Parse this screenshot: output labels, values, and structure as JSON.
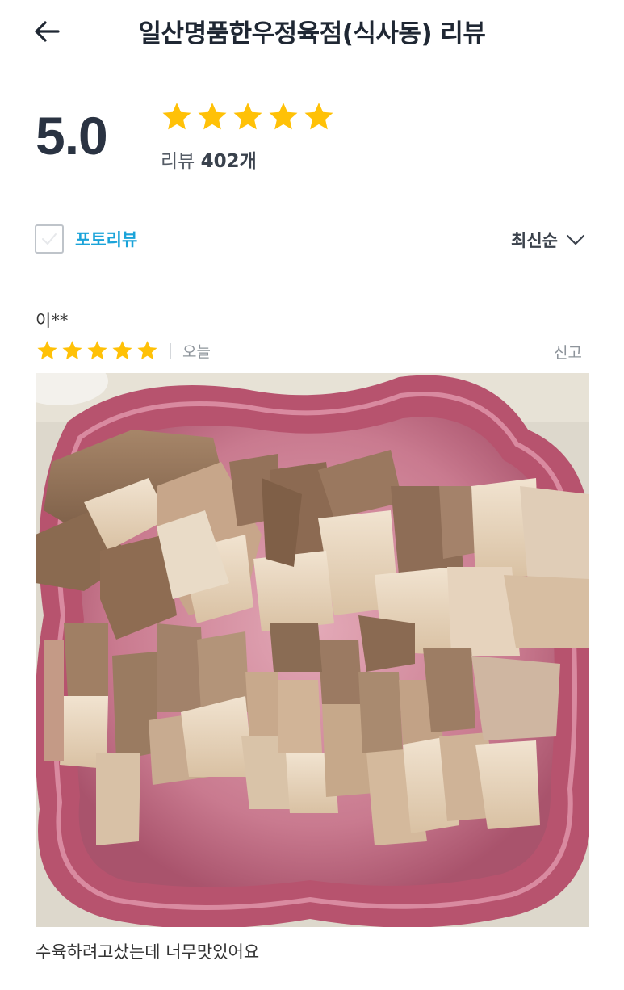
{
  "header": {
    "back_icon": "arrow-left-icon",
    "title": "일산명품한우정육점(식사동) 리뷰"
  },
  "summary": {
    "score": "5.0",
    "star_rating": 5,
    "star_color": "#FFC107",
    "count_prefix": "리뷰",
    "count_value": "402개"
  },
  "filters": {
    "photo_review_label": "포토리뷰",
    "photo_review_checked": false,
    "sort_label": "최신순",
    "sort_icon": "chevron-down-icon"
  },
  "reviews": [
    {
      "author": "이**",
      "rating": 5,
      "date": "오늘",
      "report_label": "신고",
      "photo": "boiled-pork-suyuk-on-pink-plate",
      "text": "수육하려고샀는데 너무맛있어요"
    }
  ],
  "colors": {
    "accent": "#1AA3D9",
    "title": "#1F2733",
    "star": "#FFC107",
    "muted": "#8E949B"
  }
}
